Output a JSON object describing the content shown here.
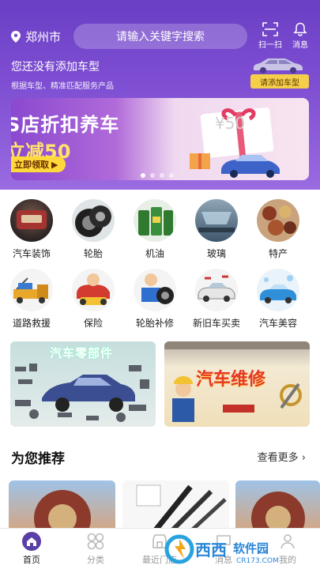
{
  "header": {
    "location": "郑州市",
    "search_placeholder": "请输入关键字搜索",
    "scan_label": "扫一扫",
    "message_label": "消息"
  },
  "car": {
    "title": "您还没有添加车型",
    "subtitle": "根据车型、精准匹配服务产品",
    "add_button": "请添加车型"
  },
  "banner": {
    "line1": "S店折扣养车",
    "line2": "立减50",
    "button": "立即领取",
    "voucher": "¥50",
    "page_count": 4,
    "active_page": 0
  },
  "categories": [
    {
      "label": "汽车装饰",
      "icon": "car-decoration-icon"
    },
    {
      "label": "轮胎",
      "icon": "tire-icon"
    },
    {
      "label": "机油",
      "icon": "engine-oil-icon"
    },
    {
      "label": "玻璃",
      "icon": "glass-icon"
    },
    {
      "label": "特产",
      "icon": "specialty-icon"
    },
    {
      "label": "道路救援",
      "icon": "road-rescue-icon"
    },
    {
      "label": "保险",
      "icon": "insurance-icon"
    },
    {
      "label": "轮胎补修",
      "icon": "tire-repair-icon"
    },
    {
      "label": "新旧车买卖",
      "icon": "car-trade-icon"
    },
    {
      "label": "汽车美容",
      "icon": "car-wash-icon"
    }
  ],
  "promos": [
    {
      "title": "汽车零部件"
    },
    {
      "title": "汽车维修"
    }
  ],
  "recommend": {
    "title": "为您推荐",
    "more": "查看更多 ›"
  },
  "tabs": [
    {
      "label": "首页",
      "active": true
    },
    {
      "label": "分类",
      "active": false
    },
    {
      "label": "最近门店",
      "active": false
    },
    {
      "label": "消息",
      "active": false
    },
    {
      "label": "我的",
      "active": false
    }
  ],
  "colors": {
    "brand_purple": "#7b4cd0",
    "accent_yellow": "#f6cf4a"
  }
}
